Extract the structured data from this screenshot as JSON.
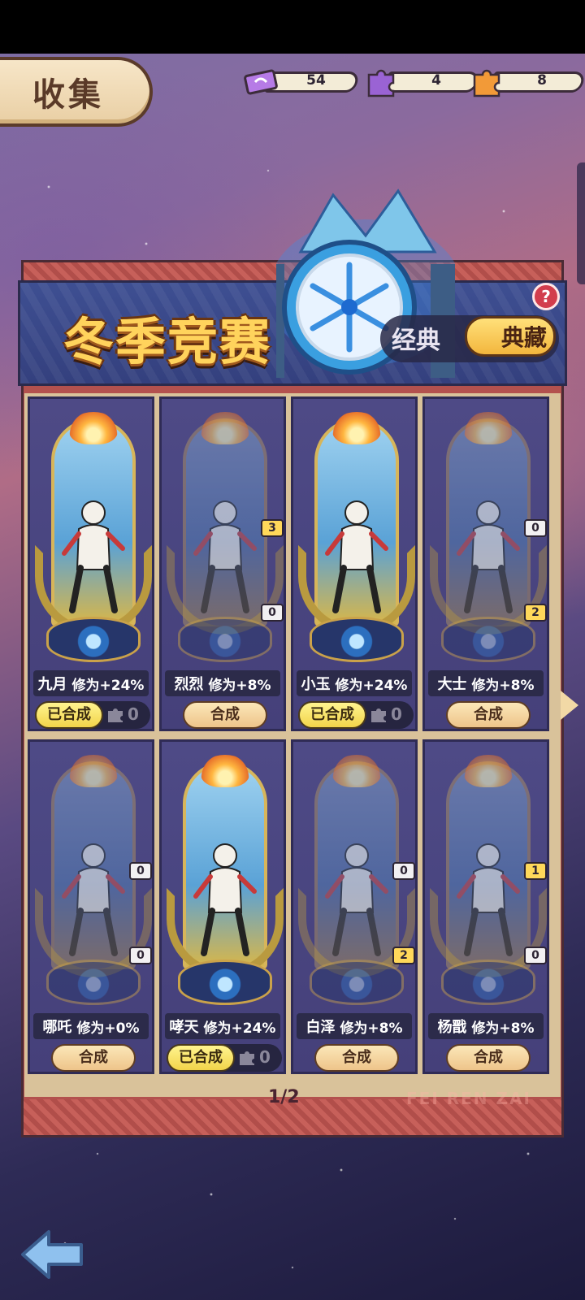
{
  "header": {
    "title": "收集"
  },
  "currencies": [
    {
      "icon": "ticket-icon",
      "value": "54",
      "color": "#a46bd8"
    },
    {
      "icon": "purple-puzzle-icon",
      "value": "4",
      "color": "#8d55c8"
    },
    {
      "icon": "orange-puzzle-icon",
      "value": "8",
      "color": "#f08c2c"
    }
  ],
  "banner": {
    "title": "冬季竞赛",
    "mode_classic": "经典",
    "mode_collection": "典藏",
    "help": "?"
  },
  "cards": [
    {
      "name": "九月",
      "bonus": "修为+24%",
      "state": "composed",
      "composed_label": "已合成",
      "pieces": "0",
      "badges": []
    },
    {
      "name": "烈烈",
      "bonus": "修为+8%",
      "state": "compose",
      "compose_label": "合成",
      "badges": [
        "3",
        "0"
      ]
    },
    {
      "name": "小玉",
      "bonus": "修为+24%",
      "state": "composed",
      "composed_label": "已合成",
      "pieces": "0",
      "badges": []
    },
    {
      "name": "大士",
      "bonus": "修为+8%",
      "state": "compose",
      "compose_label": "合成",
      "badges": [
        "0",
        "2"
      ]
    },
    {
      "name": "哪吒",
      "bonus": "修为+0%",
      "state": "compose",
      "compose_label": "合成",
      "badges": [
        "0",
        "0"
      ]
    },
    {
      "name": "哮天",
      "bonus": "修为+24%",
      "state": "composed",
      "composed_label": "已合成",
      "pieces": "0",
      "badges": []
    },
    {
      "name": "白泽",
      "bonus": "修为+8%",
      "state": "compose",
      "compose_label": "合成",
      "badges": [
        "0",
        "2"
      ]
    },
    {
      "name": "杨戬",
      "bonus": "修为+8%",
      "state": "compose",
      "compose_label": "合成",
      "badges": [
        "1",
        "0"
      ]
    }
  ],
  "pagination": {
    "indicator": "1/2"
  },
  "footer": {
    "watermark": "FEI REN ZAI"
  }
}
